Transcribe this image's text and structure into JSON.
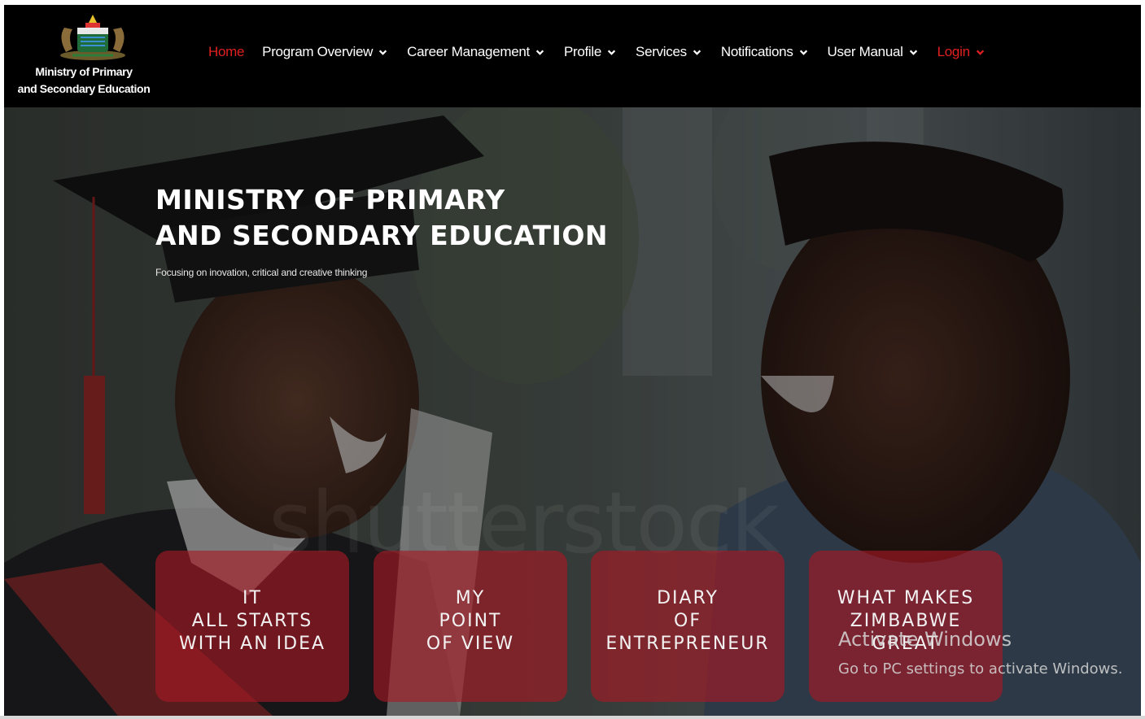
{
  "branding": {
    "logo_line1": "Ministry of Primary",
    "logo_line2": "and Secondary Education",
    "crest_icon": "coat-of-arms-icon"
  },
  "nav": {
    "items": [
      {
        "label": "Home",
        "dropdown": false,
        "active": true
      },
      {
        "label": "Program Overview",
        "dropdown": true
      },
      {
        "label": "Career Management",
        "dropdown": true
      },
      {
        "label": "Profile",
        "dropdown": true
      },
      {
        "label": "Services",
        "dropdown": true
      },
      {
        "label": "Notifications",
        "dropdown": true
      },
      {
        "label": "User Manual",
        "dropdown": true
      },
      {
        "label": "Login",
        "dropdown": true,
        "accent": true
      }
    ],
    "accent_color": "#e02020"
  },
  "hero": {
    "title_line1": "MINISTRY OF PRIMARY",
    "title_line2": "AND SECONDARY EDUCATION",
    "subtitle": "Focusing on inovation, critical and creative thinking",
    "watermark": "shutterstock",
    "cards": [
      {
        "text": "IT\nALL STARTS\nWITH AN IDEA"
      },
      {
        "text": "MY\nPOINT\nOF VIEW"
      },
      {
        "text": "DIARY\nOF\nENTREPRENEUR"
      },
      {
        "text": "WHAT MAKES\nZIMBABWE\nGREAT"
      }
    ],
    "card_color": "#aa1923"
  },
  "system_overlay": {
    "activate_title": "Activate Windows",
    "activate_hint": "Go to PC settings to activate Windows."
  }
}
